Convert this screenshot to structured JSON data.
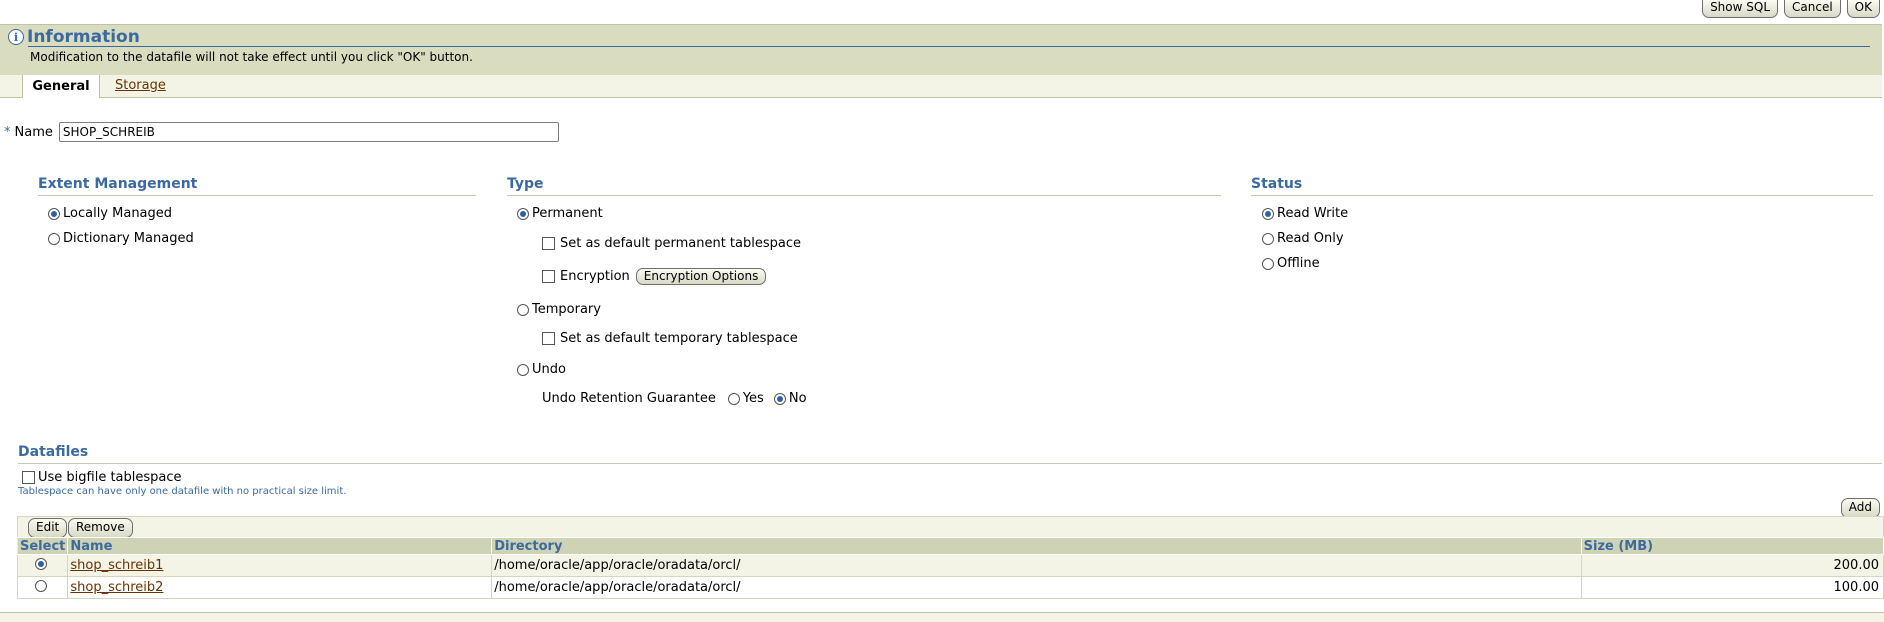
{
  "toolbar": {
    "show_sql": "Show SQL",
    "cancel": "Cancel",
    "ok": "OK"
  },
  "info": {
    "title": "Information",
    "message": "Modification to the datafile will not take effect until you click \"OK\" button."
  },
  "tabs": {
    "general": "General",
    "storage": "Storage"
  },
  "name_field": {
    "required_mark": "*",
    "label": "Name",
    "value": "SHOP_SCHREIB"
  },
  "extent": {
    "heading": "Extent Management",
    "locally": "Locally Managed",
    "dictionary": "Dictionary Managed",
    "selected": "locally"
  },
  "type": {
    "heading": "Type",
    "permanent": "Permanent",
    "default_permanent": "Set as default permanent tablespace",
    "encryption": "Encryption",
    "encryption_button": "Encryption Options",
    "temporary": "Temporary",
    "default_temporary": "Set as default temporary tablespace",
    "undo": "Undo",
    "undo_retention": "Undo Retention Guarantee",
    "yes": "Yes",
    "no": "No",
    "selected": "permanent",
    "undo_retention_selected": "no"
  },
  "status": {
    "heading": "Status",
    "read_write": "Read Write",
    "read_only": "Read Only",
    "offline": "Offline",
    "selected": "read_write"
  },
  "datafiles": {
    "heading": "Datafiles",
    "bigfile": "Use bigfile tablespace",
    "hint": "Tablespace can have only one datafile with no practical size limit.",
    "add": "Add",
    "edit": "Edit",
    "remove": "Remove",
    "columns": {
      "select": "Select",
      "name": "Name",
      "directory": "Directory",
      "size": "Size (MB)"
    },
    "rows": [
      {
        "name": "shop_schreib1",
        "directory": "/home/oracle/app/oracle/oradata/orcl/",
        "size": "200.00",
        "selected": true
      },
      {
        "name": "shop_schreib2",
        "directory": "/home/oracle/app/oracle/oradata/orcl/",
        "size": "100.00",
        "selected": false
      }
    ]
  }
}
